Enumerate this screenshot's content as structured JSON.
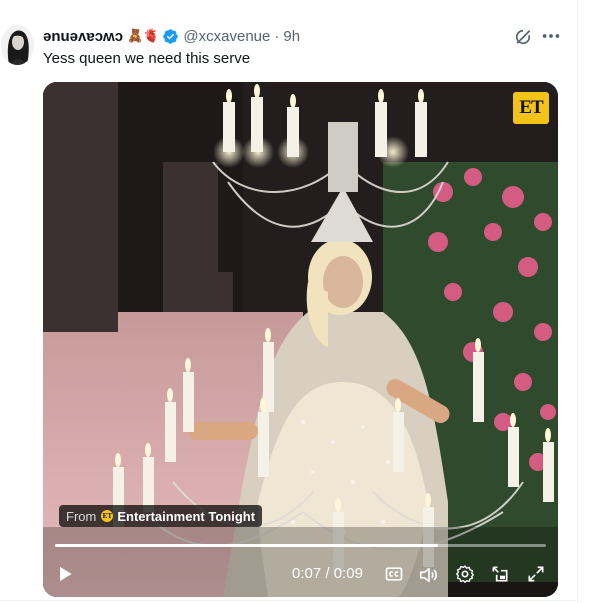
{
  "tweet": {
    "display_name": "ǝnuǝʌɐɔʍɔ",
    "name_emojis": "🧸🫀",
    "handle": "@xcxavenue",
    "separator": "·",
    "time": "9h",
    "text": "Yess queen we need this serve"
  },
  "media": {
    "brand_badge": "ET",
    "attribution": {
      "prefix": "From",
      "source_name": "Entertainment Tonight"
    },
    "player": {
      "current_time": "0:07",
      "duration": "0:09",
      "time_separator": " / ",
      "progress_fraction": 0.78
    }
  },
  "colors": {
    "verified_blue": "#1d9bf0",
    "secondary_text": "#536471",
    "et_yellow": "#f3c31a"
  },
  "icons": {
    "grok": "grok-icon",
    "more": "more-icon",
    "play": "play-icon",
    "captions": "captions-icon",
    "volume": "volume-icon",
    "settings": "settings-icon",
    "pip": "pip-icon",
    "fullscreen": "fullscreen-icon"
  }
}
